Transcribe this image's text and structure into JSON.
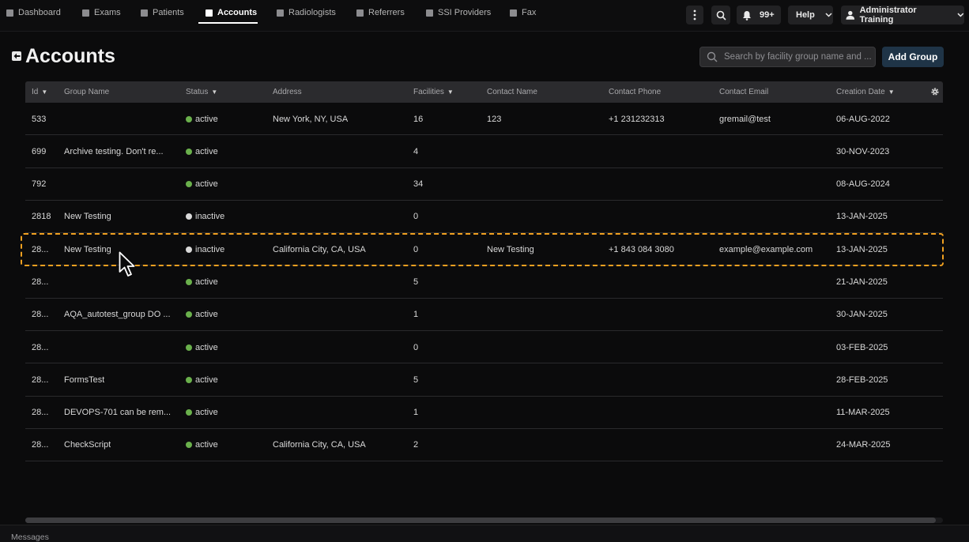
{
  "nav": {
    "items": [
      {
        "label": "Dashboard",
        "icon": "dashboard-icon"
      },
      {
        "label": "Exams",
        "icon": "exams-icon"
      },
      {
        "label": "Patients",
        "icon": "patients-icon"
      },
      {
        "label": "Accounts",
        "icon": "accounts-icon",
        "active": true
      },
      {
        "label": "Radiologists",
        "icon": "radiologists-icon"
      },
      {
        "label": "Referrers",
        "icon": "referrers-icon"
      },
      {
        "label": "SSI Providers",
        "icon": "ssi-providers-icon"
      },
      {
        "label": "Fax",
        "icon": "fax-icon"
      }
    ]
  },
  "toolbar": {
    "notifications_count": "99+",
    "help_label": "Help",
    "user_name": "Administrator Training"
  },
  "header": {
    "title": "Accounts",
    "search_placeholder": "Search by facility group name and ...",
    "add_button_label": "Add Group"
  },
  "table": {
    "columns": [
      {
        "label": "Id",
        "sortable": true
      },
      {
        "label": "Group Name",
        "sortable": false
      },
      {
        "label": "Status",
        "sortable": true
      },
      {
        "label": "Address",
        "sortable": false
      },
      {
        "label": "Facilities",
        "sortable": true
      },
      {
        "label": "Contact Name",
        "sortable": false
      },
      {
        "label": "Contact Phone",
        "sortable": false
      },
      {
        "label": "Contact Email",
        "sortable": false
      },
      {
        "label": "Creation Date",
        "sortable": true
      }
    ],
    "rows": [
      {
        "id": "533",
        "group_name": "",
        "status": "active",
        "address": "New York, NY, USA",
        "facilities": "16",
        "contact_name": "123",
        "contact_phone": "+1 231232313",
        "contact_email": "gremail@test",
        "creation_date": "06-AUG-2022"
      },
      {
        "id": "699",
        "group_name": "Archive testing. Don't re...",
        "status": "active",
        "address": "",
        "facilities": "4",
        "contact_name": "",
        "contact_phone": "",
        "contact_email": "",
        "creation_date": "30-NOV-2023"
      },
      {
        "id": "792",
        "group_name": "",
        "status": "active",
        "address": "",
        "facilities": "34",
        "contact_name": "",
        "contact_phone": "",
        "contact_email": "",
        "creation_date": "08-AUG-2024"
      },
      {
        "id": "2818",
        "group_name": "New Testing",
        "status": "inactive",
        "address": "",
        "facilities": "0",
        "contact_name": "",
        "contact_phone": "",
        "contact_email": "",
        "creation_date": "13-JAN-2025"
      },
      {
        "id": "28...",
        "group_name": "New Testing",
        "status": "inactive",
        "address": "California City, CA, USA",
        "facilities": "0",
        "contact_name": "New Testing",
        "contact_phone": "+1 843 084 3080",
        "contact_email": "example@example.com",
        "creation_date": "13-JAN-2025",
        "highlighted": true
      },
      {
        "id": "28...",
        "group_name": "",
        "status": "active",
        "address": "",
        "facilities": "5",
        "contact_name": "",
        "contact_phone": "",
        "contact_email": "",
        "creation_date": "21-JAN-2025"
      },
      {
        "id": "28...",
        "group_name": "AQA_autotest_group DO ...",
        "status": "active",
        "address": "",
        "facilities": "1",
        "contact_name": "",
        "contact_phone": "",
        "contact_email": "",
        "creation_date": "30-JAN-2025"
      },
      {
        "id": "28...",
        "group_name": "",
        "status": "active",
        "address": "",
        "facilities": "0",
        "contact_name": "",
        "contact_phone": "",
        "contact_email": "",
        "creation_date": "03-FEB-2025"
      },
      {
        "id": "28...",
        "group_name": "FormsTest",
        "status": "active",
        "address": "",
        "facilities": "5",
        "contact_name": "",
        "contact_phone": "",
        "contact_email": "",
        "creation_date": "28-FEB-2025"
      },
      {
        "id": "28...",
        "group_name": "DEVOPS-701 can be rem...",
        "status": "active",
        "address": "",
        "facilities": "1",
        "contact_name": "",
        "contact_phone": "",
        "contact_email": "",
        "creation_date": "11-MAR-2025"
      },
      {
        "id": "28...",
        "group_name": "CheckScript",
        "status": "active",
        "address": "California City, CA, USA",
        "facilities": "2",
        "contact_name": "",
        "contact_phone": "",
        "contact_email": "",
        "creation_date": "24-MAR-2025"
      }
    ]
  },
  "colors": {
    "active_status": "#6ab04c",
    "inactive_status": "#d9d9d9",
    "highlight_outline": "#f0a020",
    "add_button_bg": "#1f3447"
  },
  "footer": {
    "messages_label": "Messages"
  }
}
